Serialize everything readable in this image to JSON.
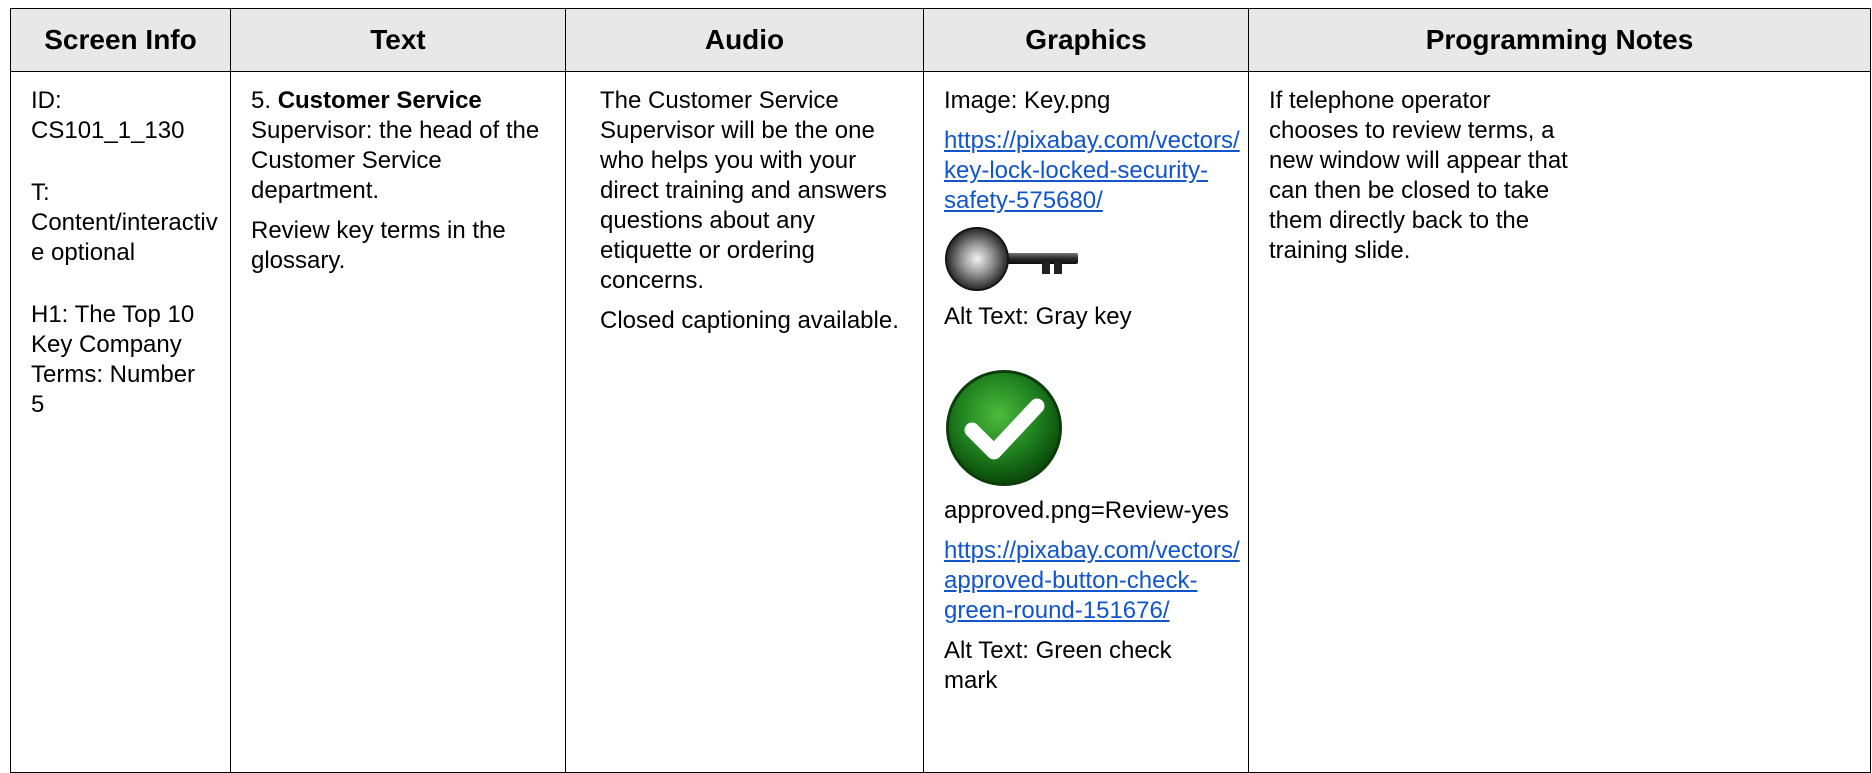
{
  "headers": [
    "Screen Info",
    "Text",
    "Audio",
    "Graphics",
    "Programming Notes"
  ],
  "screen_info": {
    "id_label": "ID:",
    "id_value": "CS101_1_130",
    "type_label": "T:",
    "type_value_line1": "Content/interactiv",
    "type_value_line2": "e optional",
    "h1_line1": "H1: The Top 10",
    "h1_line2": "Key Company",
    "h1_line3": "Terms: Number 5"
  },
  "text_col": {
    "number": "5. ",
    "term": "Customer Service",
    "definition": "Supervisor: the head of the Customer Service department.",
    "review": "Review key terms in the glossary."
  },
  "audio_col": {
    "narration": "The Customer Service Supervisor will be the one who helps you with your direct training and answers questions about any etiquette or ordering concerns.",
    "captions": "Closed captioning available."
  },
  "graphics_col": {
    "image1_label": "Image: Key.png",
    "image1_url_line1": "https://pixabay.com/vectors/",
    "image1_url_line2": "key-lock-locked-security-",
    "image1_url_line3": "safety-575680/",
    "image1_icon": "gray-key-icon",
    "image1_alt": "Alt Text: Gray key",
    "image2_icon": "green-check-icon",
    "image2_label": "approved.png=Review-yes",
    "image2_url_line1": "https://pixabay.com/vectors/",
    "image2_url_line2": "approved-button-check-",
    "image2_url_line3": "green-round-151676/",
    "image2_alt": "Alt Text: Green check mark"
  },
  "programming_notes": {
    "note": "If telephone operator chooses to review terms, a new window will appear that can then be closed to take them directly back to the training slide."
  },
  "colors": {
    "header_bg": "#e8e8e8",
    "link": "#1155cc",
    "check_green": "#1e7f1e"
  }
}
